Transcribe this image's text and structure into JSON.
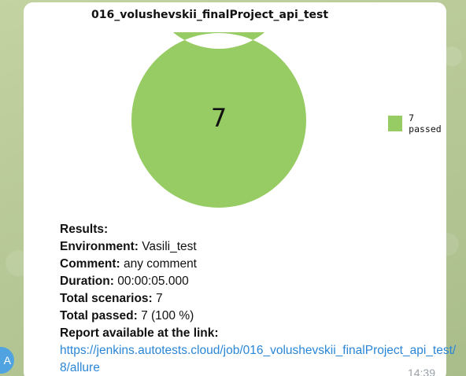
{
  "message": {
    "chart_title": "016_volushevskii_finalProject_api_test",
    "results_heading": "Results:",
    "environment_label": "Environment:",
    "environment_value": "Vasili_test",
    "comment_label": "Comment:",
    "comment_value": "any comment",
    "duration_label": "Duration:",
    "duration_value": "00:00:05.000",
    "total_scenarios_label": "Total scenarios:",
    "total_scenarios_value": "7",
    "total_passed_label": "Total passed:",
    "total_passed_value": "7 (100 %)",
    "report_label": "Report available at the link:",
    "report_url": "https://jenkins.autotests.cloud/job/016_volushevskii_finalProject_api_test/8/allure",
    "time": "14:39"
  },
  "avatar": {
    "initial": "A",
    "color": "#4fa3e0"
  },
  "chart_data": {
    "type": "pie",
    "title": "016_volushevskii_finalProject_api_test",
    "center_label": "7",
    "categories": [
      "passed"
    ],
    "values": [
      7
    ],
    "legend": [
      "7 passed"
    ],
    "legend_position": "right",
    "colors": {
      "passed": "#97cc64"
    }
  }
}
